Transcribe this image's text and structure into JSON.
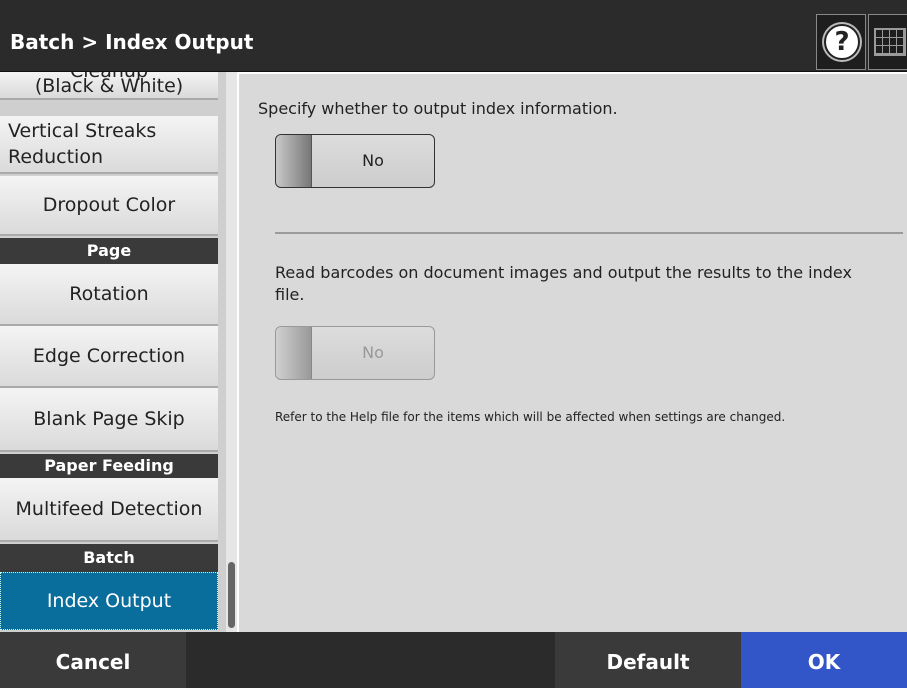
{
  "header": {
    "title": "Batch > Index Output",
    "help_label": "?"
  },
  "sidebar": {
    "items": [
      {
        "label_top": "Cleanup",
        "label": "(Black & White)"
      },
      {
        "label": "Vertical Streaks Reduction"
      },
      {
        "label": "Dropout Color"
      },
      {
        "header": "Page"
      },
      {
        "label": "Rotation"
      },
      {
        "label": "Edge Correction"
      },
      {
        "label": "Blank Page Skip"
      },
      {
        "header": "Paper Feeding"
      },
      {
        "label": "Multifeed Detection"
      },
      {
        "header": "Batch"
      },
      {
        "label": "Index Output",
        "selected": true
      }
    ]
  },
  "main": {
    "index_output": {
      "description": "Specify whether to output index information.",
      "value": "No"
    },
    "barcode": {
      "description": "Read barcodes on document images and output the results to the index file.",
      "value": "No",
      "enabled": false
    },
    "note": "Refer to the Help file for the items which will be affected when settings are changed."
  },
  "footer": {
    "cancel_label": "Cancel",
    "default_label": "Default",
    "ok_label": "OK"
  },
  "colors": {
    "selected_item": "#0a6e9c",
    "ok_button": "#3255c8",
    "titlebar": "#2b2b2b"
  }
}
